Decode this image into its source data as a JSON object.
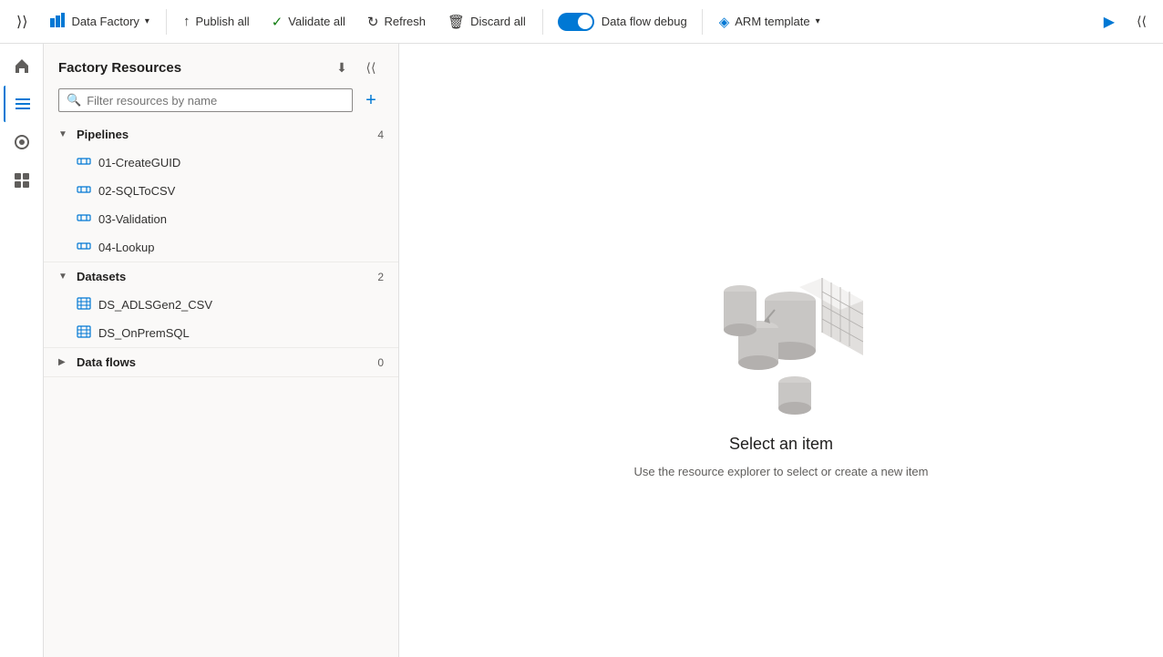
{
  "toolbar": {
    "factory_name": "Data Factory",
    "publish_all_label": "Publish all",
    "validate_all_label": "Validate all",
    "refresh_label": "Refresh",
    "discard_all_label": "Discard all",
    "data_flow_debug_label": "Data flow debug",
    "arm_template_label": "ARM template",
    "debug_enabled": true
  },
  "side_panel": {
    "title": "Factory Resources",
    "search_placeholder": "Filter resources by name",
    "add_button_label": "+",
    "sections": [
      {
        "id": "pipelines",
        "name": "Pipelines",
        "count": 4,
        "expanded": true,
        "items": [
          {
            "label": "01-CreateGUID"
          },
          {
            "label": "02-SQLToCSV"
          },
          {
            "label": "03-Validation"
          },
          {
            "label": "04-Lookup"
          }
        ]
      },
      {
        "id": "datasets",
        "name": "Datasets",
        "count": 2,
        "expanded": true,
        "items": [
          {
            "label": "DS_ADLSGen2_CSV"
          },
          {
            "label": "DS_OnPremSQL"
          }
        ]
      },
      {
        "id": "dataflows",
        "name": "Data flows",
        "count": 0,
        "expanded": false,
        "items": []
      }
    ]
  },
  "main_content": {
    "empty_title": "Select an item",
    "empty_desc": "Use the resource explorer to select or create a new item"
  },
  "nav_icons": [
    {
      "id": "home",
      "symbol": "⌂",
      "active": false
    },
    {
      "id": "edit",
      "symbol": "✏",
      "active": true
    },
    {
      "id": "monitor",
      "symbol": "◎",
      "active": false
    },
    {
      "id": "manage",
      "symbol": "⚙",
      "active": false
    }
  ]
}
